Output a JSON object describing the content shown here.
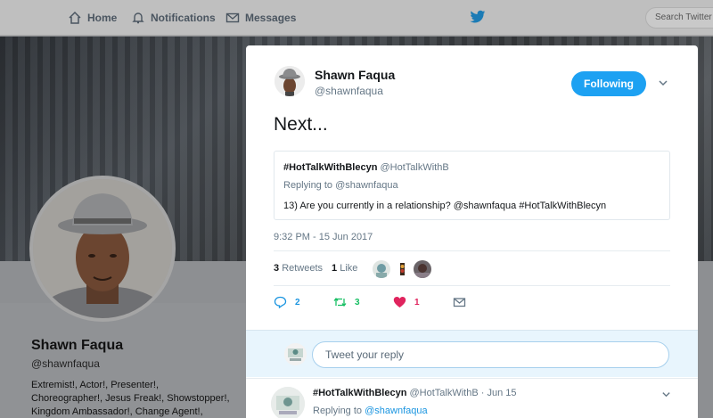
{
  "nav": {
    "home": "Home",
    "notifications": "Notifications",
    "messages": "Messages",
    "search_placeholder": "Search Twitter"
  },
  "profile": {
    "name": "Shawn Faqua",
    "handle": "@shawnfaqua",
    "bio_line1": "Extremist!, Actor!, Presenter!,",
    "bio_line2": "Choreographer!, Jesus Freak!, Showstopper!,",
    "bio_line3": "Kingdom Ambassador!, Change Agent!,"
  },
  "tweet": {
    "author_name": "Shawn Faqua",
    "author_handle": "@shawnfaqua",
    "follow_label": "Following",
    "text": "Next...",
    "timestamp": "9:32 PM - 15 Jun 2017",
    "retweets_count": "3",
    "retweets_label": "Retweets",
    "likes_count": "1",
    "likes_label": "Like",
    "quoted": {
      "name": "#HotTalkWithBlecyn",
      "handle": "@HotTalkWithB",
      "replying_to": "Replying to @shawnfaqua",
      "text": "13) Are you currently in a relationship? @shawnfaqua #HotTalkWithBlecyn"
    },
    "actions": {
      "reply_count": "2",
      "retweet_count": "3",
      "like_count": "1"
    }
  },
  "reply_box": {
    "placeholder": "Tweet your reply"
  },
  "reply_tweet": {
    "name": "#HotTalkWithBlecyn",
    "meta": "@HotTalkWithB · Jun 15",
    "replying_prefix": "Replying to",
    "replying_handle": "@shawnfaqua"
  },
  "colors": {
    "accent": "#1da1f2",
    "retweet": "#17bf63",
    "like": "#e0245e",
    "muted": "#657786"
  }
}
